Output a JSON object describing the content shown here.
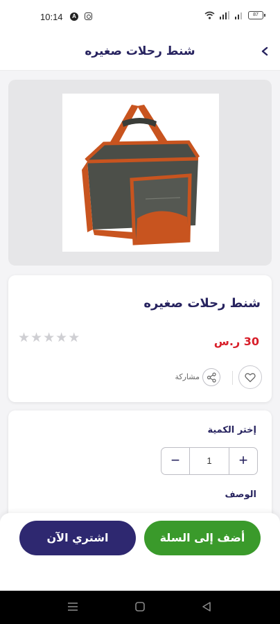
{
  "status_bar": {
    "time": "10:14",
    "a_badge": "A",
    "battery": "87",
    "icons": [
      "a-badge-icon",
      "instagram-icon",
      "wifi-icon",
      "signal-icon",
      "battery-icon"
    ]
  },
  "header": {
    "title": "شنط رحلات صغيره",
    "back_icon": "chevron-left-icon"
  },
  "product": {
    "name": "شنط رحلات صغيره",
    "price": "30 ر.س",
    "rating": 0,
    "rating_max": 5,
    "share_label": "مشاركة",
    "image": "trip-cooler-bag-orange-grey"
  },
  "quantity": {
    "label": "إختر الكمية",
    "value": "1",
    "minus": "−",
    "plus": "+"
  },
  "description": {
    "label": "الوصف"
  },
  "actions": {
    "buy_now": "اشتري الآن",
    "add_to_cart": "أضف إلى السلة"
  },
  "colors": {
    "primary": "#2e2870",
    "title": "#27235f",
    "green": "#3a9a2b",
    "price": "#d81f2a"
  }
}
